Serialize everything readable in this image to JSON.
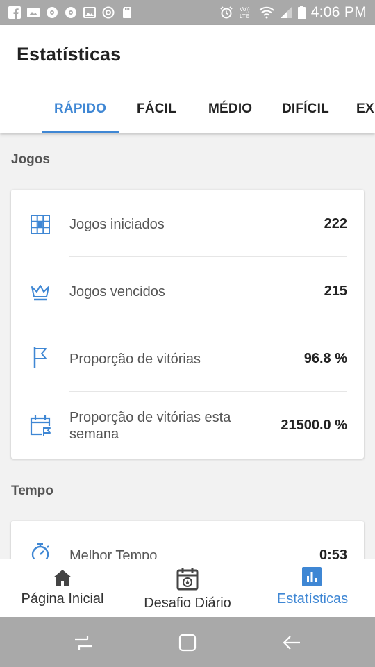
{
  "status_bar": {
    "time": "4:06 PM",
    "left_icons": [
      "facebook-icon",
      "gallery-icon",
      "podcast-icon",
      "podcast-icon",
      "image-icon",
      "chrome-icon",
      "sd-card-icon"
    ],
    "right_icons": [
      "alarm-icon",
      "volte-icon",
      "wifi-icon",
      "signal-icon",
      "battery-icon"
    ],
    "volte_label": "Vo))\nLTE"
  },
  "header": {
    "title": "Estatísticas"
  },
  "tabs": [
    {
      "label": "RÁPIDO",
      "active": true
    },
    {
      "label": "FÁCIL",
      "active": false
    },
    {
      "label": "MÉDIO",
      "active": false
    },
    {
      "label": "DIFÍCIL",
      "active": false
    },
    {
      "label": "EXPERT",
      "active": false
    }
  ],
  "sections": {
    "jogos": {
      "title": "Jogos",
      "rows": [
        {
          "icon": "grid-icon",
          "label": "Jogos iniciados",
          "value": "222"
        },
        {
          "icon": "crown-icon",
          "label": "Jogos vencidos",
          "value": "215"
        },
        {
          "icon": "flag-icon",
          "label": "Proporção de vitórias",
          "value": "96.8 %"
        },
        {
          "icon": "calendar-flag-icon",
          "label": "Proporção de vitórias esta semana",
          "value": "21500.0 %"
        }
      ]
    },
    "tempo": {
      "title": "Tempo",
      "rows": [
        {
          "icon": "stopwatch-icon",
          "label": "Melhor Tempo",
          "value": "0:53"
        }
      ]
    }
  },
  "bottom_nav": [
    {
      "icon": "home-icon",
      "label": "Página Inicial",
      "active": false
    },
    {
      "icon": "calendar-star-icon",
      "label": "Desafio Diário",
      "active": false
    },
    {
      "icon": "bar-chart-icon",
      "label": "Estatísticas",
      "active": true
    }
  ],
  "system_nav": [
    "recent-apps-icon",
    "home-button-icon",
    "back-icon"
  ],
  "colors": {
    "accent": "#3f87d4",
    "status_bar": "#a9a9a9",
    "background": "#f2f2f2",
    "card": "#ffffff"
  }
}
